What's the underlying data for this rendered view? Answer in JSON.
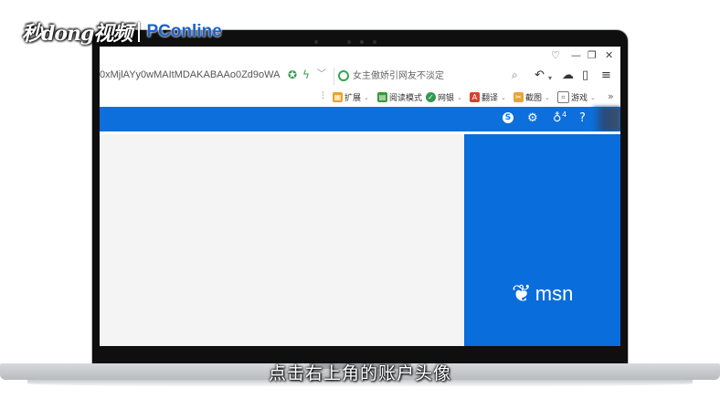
{
  "watermark": {
    "brand": "秒dong视频",
    "partner": "PConline"
  },
  "browser": {
    "url": "0xMjlAYy0wMAItMDAKABAAo0Zd9oWA",
    "search_placeholder": "女主傲娇引网友不淡定",
    "toolbar_extensions": [
      {
        "label": "扩展",
        "icon_color": "#e9a228"
      },
      {
        "label": "阅读模式",
        "icon_color": "#3a9a3a"
      },
      {
        "label": "网银",
        "icon_color": "#2f9a50"
      },
      {
        "label": "翻译",
        "icon_color": "#d9412d"
      },
      {
        "label": "截图",
        "icon_color": "#e8a33a"
      },
      {
        "label": "游戏",
        "icon_color": "#777777"
      }
    ],
    "more_glyph": "»"
  },
  "msn": {
    "notification_count": "4",
    "brand_text": "msn",
    "bar_color": "#0c6fdc"
  },
  "caption": "点击右上角的账户头像"
}
